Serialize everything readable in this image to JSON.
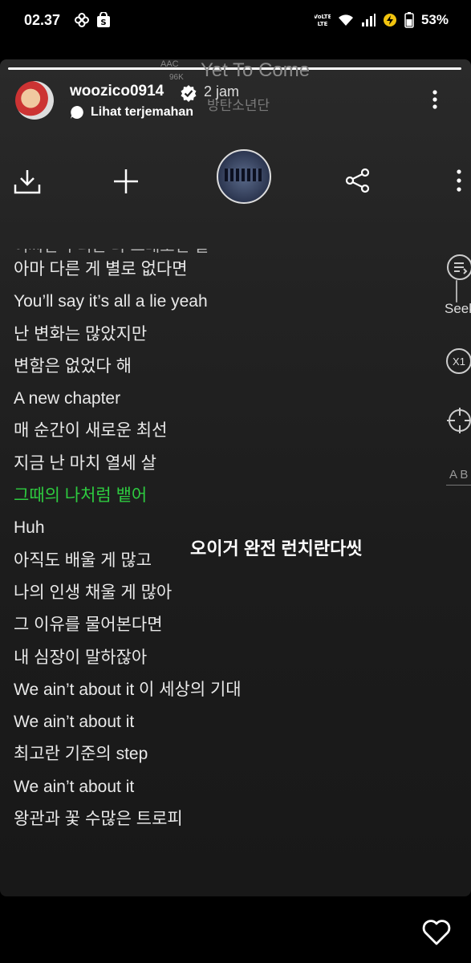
{
  "status_bar": {
    "time": "02.37",
    "battery_percent": "53%"
  },
  "story": {
    "progress_fraction": 1.0,
    "username": "woozico0914",
    "time_ago": "2 jam",
    "translate_label": "Lihat terjemahan"
  },
  "player": {
    "codec": "AAC",
    "bitrate": "96K",
    "song_title": "Yet To Come",
    "artist": "방탄소년단",
    "partial_top_line": "어쩌면 우리는 다 그대로인 걸",
    "lyrics": [
      {
        "text": "아마 다른 게 별로 없다면",
        "active": false
      },
      {
        "text": "You’ll say it’s all a lie yeah",
        "active": false
      },
      {
        "text": "난 변화는 많았지만",
        "active": false
      },
      {
        "text": "변함은 없었다 해",
        "active": false
      },
      {
        "text": "A new chapter",
        "active": false
      },
      {
        "text": "매 순간이 새로운 최선",
        "active": false
      },
      {
        "text": "지금 난 마치 열세 살",
        "active": false
      },
      {
        "text": "그때의 나처럼 뱉어",
        "active": true
      },
      {
        "text": "Huh",
        "active": false
      },
      {
        "text": "아직도 배울 게 많고",
        "active": false
      },
      {
        "text": "나의 인생 채울 게 많아",
        "active": false
      },
      {
        "text": "그 이유를 물어본다면",
        "active": false
      },
      {
        "text": "내 심장이 말하잖아",
        "active": false
      },
      {
        "text": "We ain’t about it 이 세상의 기대",
        "active": false
      },
      {
        "text": "We ain’t about it",
        "active": false
      },
      {
        "text": "최고란 기준의 step",
        "active": false
      },
      {
        "text": "We ain’t about it",
        "active": false
      },
      {
        "text": "왕관과 꽃 수많은 트로피",
        "active": false
      }
    ],
    "side": {
      "seek_label": "Seek",
      "speed_label": "X1",
      "ab_label": "A B"
    }
  },
  "sticker_text": "오이거 완전 런치란다씻",
  "colors": {
    "active_lyric": "#2ecc40",
    "lyric": "#e9e9e9",
    "background": "#000000"
  }
}
